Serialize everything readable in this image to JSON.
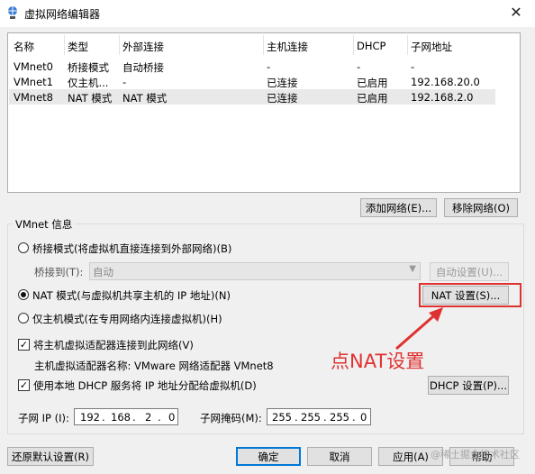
{
  "window": {
    "title": "虚拟网络编辑器",
    "close_glyph": "✕",
    "accent": "#0078d7"
  },
  "table": {
    "headers": [
      "名称",
      "类型",
      "外部连接",
      "主机连接",
      "DHCP",
      "子网地址"
    ],
    "rows": [
      [
        "VMnet0",
        "桥接模式",
        "自动桥接",
        "-",
        "-",
        "-"
      ],
      [
        "VMnet1",
        "仅主机...",
        "-",
        "已连接",
        "已启用",
        "192.168.20.0"
      ],
      [
        "VMnet8",
        "NAT 模式",
        "NAT 模式",
        "已连接",
        "已启用",
        "192.168.2.0"
      ]
    ],
    "selected_row": 2
  },
  "network_buttons": {
    "add": "添加网络(E)...",
    "remove": "移除网络(O)"
  },
  "vmnet_info": {
    "title": "VMnet 信息",
    "bridge_radio": "桥接模式(将虚拟机直接连接到外部网络)(B)",
    "bridge_to_label": "桥接到(T):",
    "bridge_to_value": "自动",
    "auto_settings": "自动设置(U)...",
    "nat_radio": "NAT 模式(与虚拟机共享主机的 IP 地址)(N)",
    "nat_settings": "NAT 设置(S)...",
    "hostonly_radio": "仅主机模式(在专用网络内连接虚拟机)(H)",
    "selected_mode": "nat",
    "connect_adapter_check": "将主机虚拟适配器连接到此网络(V)",
    "connect_adapter_checked": true,
    "adapter_name": "主机虚拟适配器名称: VMware 网络适配器 VMnet8",
    "dhcp_check": "使用本地 DHCP 服务将 IP 地址分配给虚拟机(D)",
    "dhcp_checked": true,
    "dhcp_settings": "DHCP 设置(P)...",
    "subnet_ip_label": "子网 IP (I):",
    "subnet_ip": [
      "192",
      "168",
      "2",
      "0"
    ],
    "subnet_mask_label": "子网掩码(M):",
    "subnet_mask": [
      "255",
      "255",
      "255",
      "0"
    ]
  },
  "footer": {
    "restore": "还原默认设置(R)",
    "ok": "确定",
    "cancel": "取消",
    "apply": "应用(A)",
    "help": "帮助"
  },
  "annotation": {
    "text": "点NAT设置",
    "color": "#e03131"
  },
  "watermark": "@稀土掘金技术社区"
}
